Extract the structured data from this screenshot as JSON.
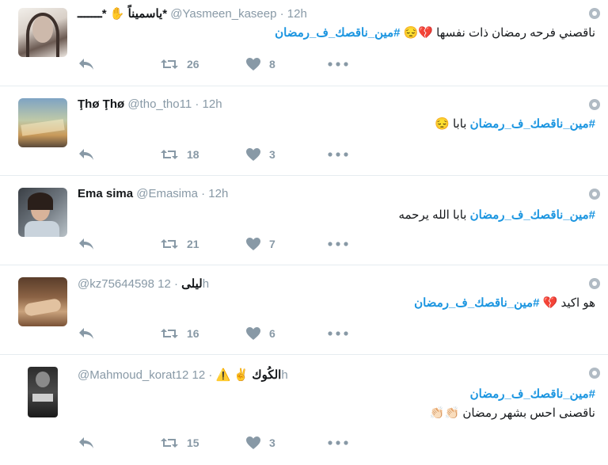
{
  "colors": {
    "hashtag": "#1b95e0",
    "muted": "#8899a6",
    "text": "#14171a"
  },
  "tweets": [
    {
      "name": "ياسميناً ✋ *ـــــــ*",
      "handle": "@Yasmeen_kaseep",
      "time": "· 12h",
      "line1": "ناقصني فرحه رمضان ذات نفسها 💔😔",
      "hashtag": "#مين_ناقصك_ف_رمضان",
      "retweets": "26",
      "likes": "8"
    },
    {
      "name": "Ţhø Ţhø",
      "handle": "@tho_tho11",
      "time": "· 12h",
      "hashtag": "#مين_ناقصك_ف_رمضان",
      "line1": "بابا 😔",
      "retweets": "18",
      "likes": "3"
    },
    {
      "name": "Ema sima",
      "handle": "@Emasima",
      "time": "· 12h",
      "hashtag": "#مين_ناقصك_ف_رمضان",
      "line1": "بابا الله يرحمه",
      "retweets": "21",
      "likes": "7"
    },
    {
      "name": "ليلى",
      "handle": "@kz75644598",
      "time": "· 12h",
      "line1": "هو اكيد 💔",
      "hashtag": "#مين_ناقصك_ف_رمضان",
      "retweets": "16",
      "likes": "6"
    },
    {
      "name": "الكُوك ✌️ ⚠️",
      "handle": "@Mahmoud_korat12",
      "time": "· 12h",
      "hashtag": "#مين_ناقصك_ف_رمضان",
      "line2": "ناقصنى احس بشهر رمضان 👏🏻👏🏻",
      "retweets": "15",
      "likes": "3"
    }
  ]
}
